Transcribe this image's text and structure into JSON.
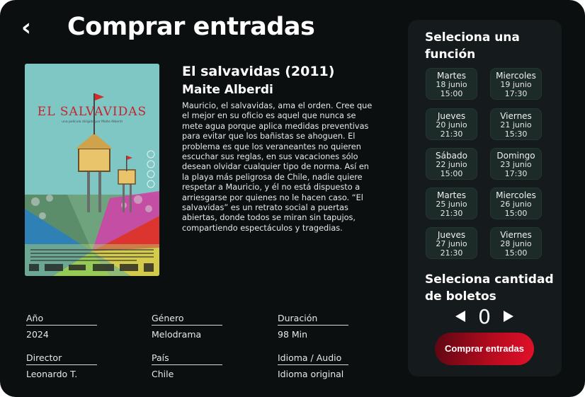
{
  "header": {
    "back_icon": "chevron-left-icon",
    "back_glyph": "‹",
    "title": "Comprar entradas"
  },
  "poster": {
    "title_text": "EL SALVAVIDAS",
    "subtitle_text": "una película dirigida por Maite Alberdi",
    "colors": {
      "background": "#7ec7c4",
      "title": "#c8232c"
    }
  },
  "movie": {
    "title": "El salvavidas (2011)",
    "director": "Maite Alberdi",
    "synopsis": "Mauricio, el salvavidas, ama el orden. Cree que el mejor en su oficio es aquel que nunca se mete agua porque aplica medidas preventivas para evitar que los bañistas se ahoguen. El problema es que los veraneantes no quieren escuchar sus reglas, en sus vacaciones sólo desean olvidar cualquier tipo de norma. Así en la playa más peligrosa de Chile, nadie quiere respetar a Mauricio, y él no está dispuesto a arriesgarse por quienes no le hacen caso. “El salvavidas” es un retrato social a puertas abiertas, donde todos se miran sin tapujos, compartiendo espectáculos y tragedias."
  },
  "details": [
    {
      "label": "Año",
      "value": "2024"
    },
    {
      "label": "Género",
      "value": "Melodrama"
    },
    {
      "label": "Duración",
      "value": "98 Min"
    },
    {
      "label": "Director",
      "value": "Leonardo T."
    },
    {
      "label": "País",
      "value": "Chile"
    },
    {
      "label": "Idioma / Audio",
      "value": "Idioma original"
    }
  ],
  "panel": {
    "functions_title": "Seleciona una función",
    "functions": [
      {
        "day": "Martes",
        "date": "18 junio",
        "time": "15:00"
      },
      {
        "day": "Miercoles",
        "date": "19 junio",
        "time": "17:30"
      },
      {
        "day": "Jueves",
        "date": "20 junio",
        "time": "21:30"
      },
      {
        "day": "Viernes",
        "date": "21 junio",
        "time": "15:30"
      },
      {
        "day": "Sábado",
        "date": "22 junio",
        "time": "15:00"
      },
      {
        "day": "Domingo",
        "date": "23 junio",
        "time": "17:30"
      },
      {
        "day": "Martes",
        "date": "25 junio",
        "time": "21:30"
      },
      {
        "day": "Miercoles",
        "date": "26 junio",
        "time": "15:00"
      },
      {
        "day": "Jueves",
        "date": "27 junio",
        "time": "21:30"
      },
      {
        "day": "Viernes",
        "date": "28 junio",
        "time": "15:00"
      }
    ],
    "quantity_title": "Seleciona cantidad de boletos",
    "quantity": "0",
    "decrease_icon": "triangle-left-icon",
    "increase_icon": "triangle-right-icon",
    "buy_label": "Comprar entradas",
    "colors": {
      "panel": "#151b1c",
      "card": "#1d2b28",
      "buy": "#c20d22"
    }
  }
}
